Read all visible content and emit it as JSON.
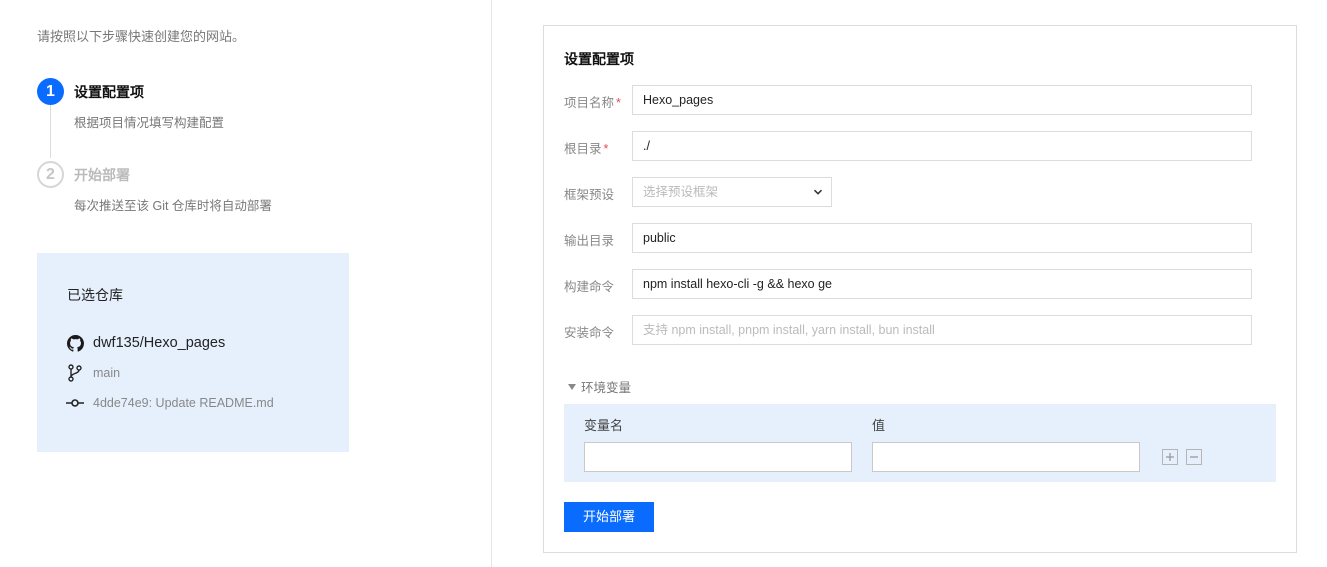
{
  "intro": "请按照以下步骤快速创建您的网站。",
  "steps": [
    {
      "number": "1",
      "title": "设置配置项",
      "desc": "根据项目情况填写构建配置"
    },
    {
      "number": "2",
      "title": "开始部署",
      "desc": "每次推送至该 Git 仓库时将自动部署"
    }
  ],
  "repo": {
    "title": "已选仓库",
    "name": "dwf135/Hexo_pages",
    "branch": "main",
    "commit": "4dde74e9: Update README.md"
  },
  "form": {
    "title": "设置配置项",
    "project_name": {
      "label": "项目名称",
      "value": "Hexo_pages",
      "required": true
    },
    "root_dir": {
      "label": "根目录",
      "value": "./",
      "required": true
    },
    "framework": {
      "label": "框架预设",
      "placeholder": "选择预设框架"
    },
    "output_dir": {
      "label": "输出目录",
      "value": "public"
    },
    "build_cmd": {
      "label": "构建命令",
      "value": "npm install hexo-cli -g && hexo ge"
    },
    "install_cmd": {
      "label": "安装命令",
      "placeholder": "支持 npm install, pnpm install, yarn install, bun install"
    },
    "env": {
      "toggle_label": "环境变量",
      "name_header": "变量名",
      "value_header": "值"
    },
    "submit_label": "开始部署"
  },
  "required_mark": "*",
  "colors": {
    "accent": "#0a6cff",
    "card_bg": "#e6f0fd",
    "required": "#e34d59"
  }
}
